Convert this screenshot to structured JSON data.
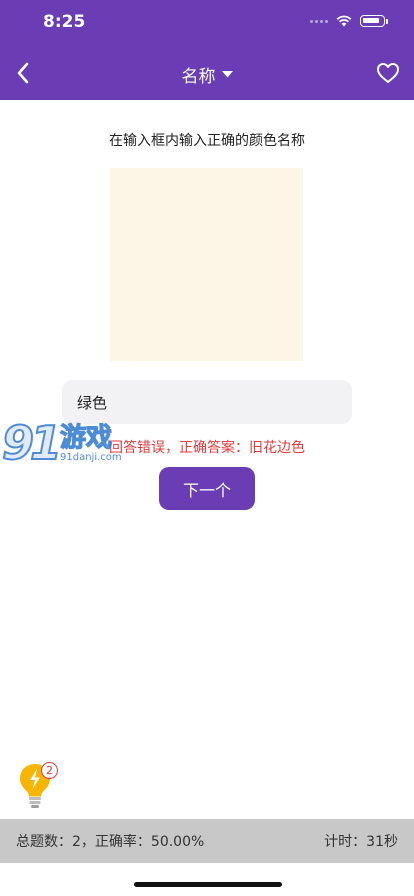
{
  "status_bar": {
    "time": "8:25"
  },
  "nav": {
    "title": "名称"
  },
  "quiz": {
    "instruction": "在输入框内输入正确的颜色名称",
    "swatch_color": "#fdf5e6",
    "answer_value": "绿色",
    "feedback": "回答错误，正确答案：旧花边色",
    "next_label": "下一个"
  },
  "watermark": {
    "logo": "91",
    "title": "游戏",
    "subtitle": "91danji.com"
  },
  "hint": {
    "count": "2"
  },
  "stats": {
    "summary": "总题数：2，正确率：50.00%",
    "timer": "计时：31秒"
  },
  "colors": {
    "brand": "#6a3db5",
    "error": "#e23b3b",
    "stats_bg": "#c8c8c8"
  }
}
